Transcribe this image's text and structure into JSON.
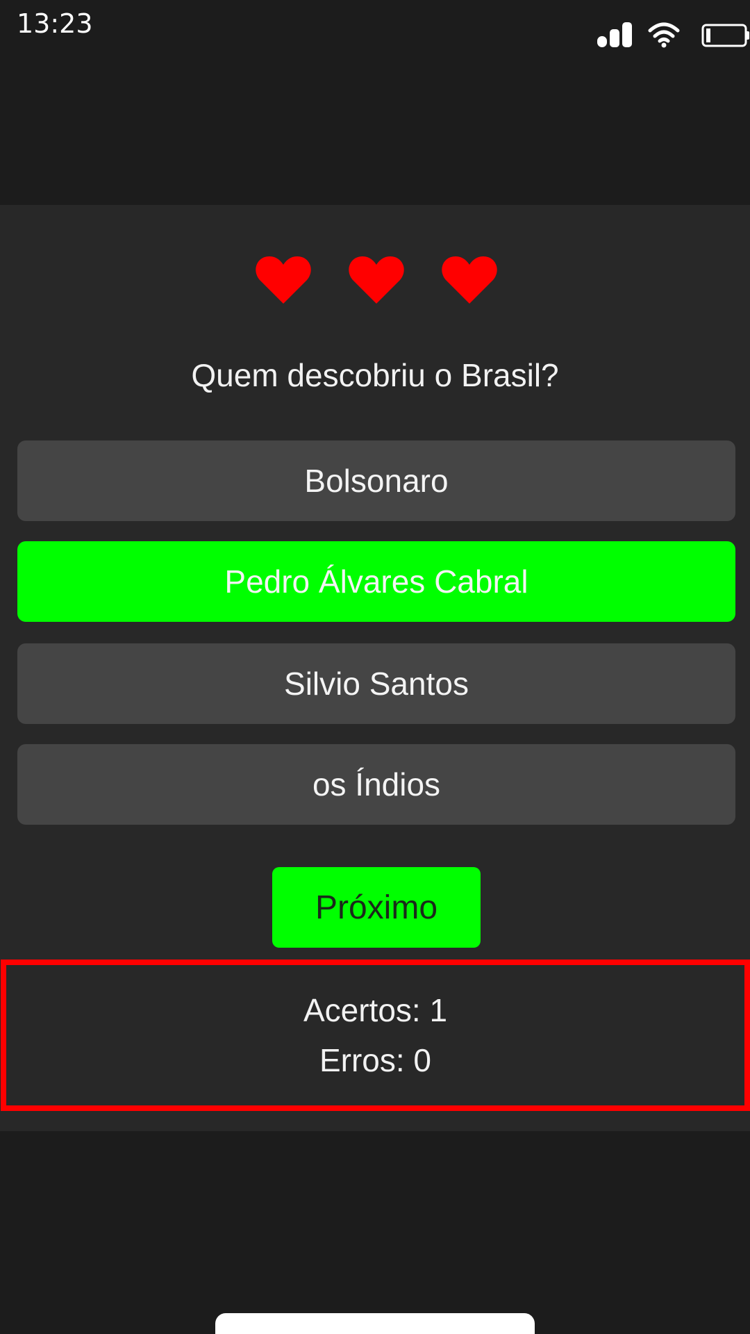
{
  "status_bar": {
    "time": "13:23",
    "icons": [
      "signal-icon",
      "wifi-icon",
      "battery-icon"
    ]
  },
  "quiz": {
    "lives": 3,
    "heart_color": "#ff0000",
    "question": "Quem descobriu o Brasil?",
    "options": [
      {
        "label": "Bolsonaro",
        "state": "default"
      },
      {
        "label": "Pedro Álvares Cabral",
        "state": "correct"
      },
      {
        "label": "Silvio Santos",
        "state": "default"
      },
      {
        "label": "os Índios",
        "state": "default"
      }
    ],
    "next_label": "Próximo",
    "accent_color": "#00ff00"
  },
  "score": {
    "hits_label": "Acertos: 1",
    "errors_label": "Erros: 0",
    "border_color": "#ff0000"
  }
}
